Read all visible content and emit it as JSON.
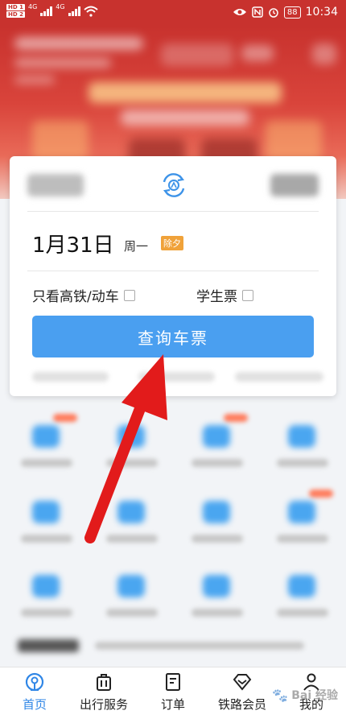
{
  "status_bar": {
    "sim1": "HD 1",
    "sim2": "HD 2",
    "net1": "4G",
    "net2": "4G",
    "battery": "88",
    "time": "10:34"
  },
  "search_card": {
    "date": "1月31日",
    "weekday": "周一",
    "festival": "除夕",
    "high_speed_only": "只看高铁/动车",
    "student_ticket": "学生票",
    "query_button": "查询车票"
  },
  "bottom_nav": {
    "items": [
      {
        "label": "首页",
        "icon": "train-logo-icon",
        "active": true
      },
      {
        "label": "出行服务",
        "icon": "luggage-icon",
        "active": false
      },
      {
        "label": "订单",
        "icon": "order-icon",
        "active": false
      },
      {
        "label": "铁路会员",
        "icon": "diamond-icon",
        "active": false
      },
      {
        "label": "我的",
        "icon": "user-icon",
        "active": false
      }
    ]
  },
  "watermark": {
    "text": "Bai 经验"
  },
  "colors": {
    "accent": "#2f86e6",
    "button": "#4a9ff0",
    "banner": "#c8322e",
    "festival_tag": "#f0a23a",
    "arrow": "#e21b1b"
  }
}
